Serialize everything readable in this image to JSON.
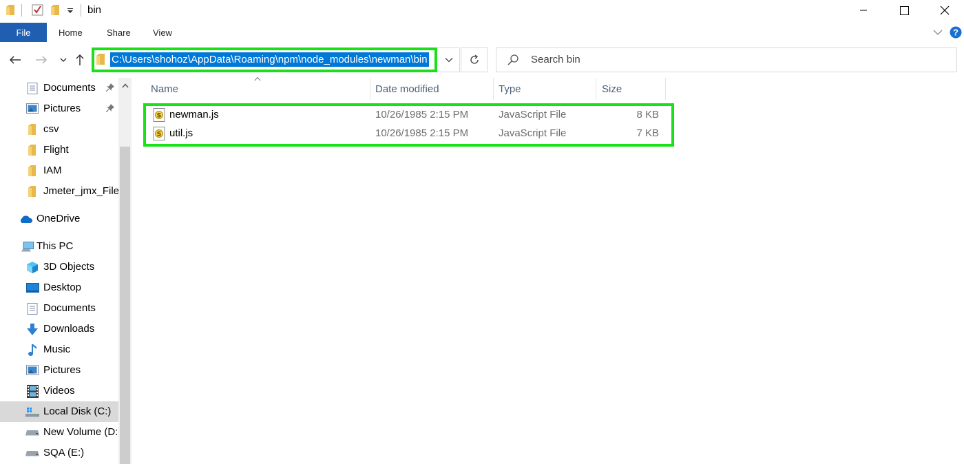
{
  "window": {
    "title": "bin"
  },
  "ribbon": {
    "tabs": [
      "File",
      "Home",
      "Share",
      "View"
    ]
  },
  "address_bar": {
    "path": "C:\\Users\\shohoz\\AppData\\Roaming\\npm\\node_modules\\newman\\bin"
  },
  "search": {
    "placeholder": "Search bin"
  },
  "sidebar": {
    "quick_access": [
      {
        "label": "Documents",
        "icon": "documents-icon",
        "pinned": true
      },
      {
        "label": "Pictures",
        "icon": "pictures-icon",
        "pinned": true
      },
      {
        "label": "csv",
        "icon": "folder-icon",
        "pinned": false
      },
      {
        "label": "Flight",
        "icon": "folder-icon",
        "pinned": false
      },
      {
        "label": "IAM",
        "icon": "folder-icon",
        "pinned": false
      },
      {
        "label": "Jmeter_jmx_Files",
        "icon": "folder-icon",
        "pinned": false
      }
    ],
    "onedrive": "OneDrive",
    "this_pc": "This PC",
    "pc_items": [
      {
        "label": "3D Objects",
        "icon": "3d-objects-icon"
      },
      {
        "label": "Desktop",
        "icon": "desktop-icon"
      },
      {
        "label": "Documents",
        "icon": "documents-icon"
      },
      {
        "label": "Downloads",
        "icon": "downloads-icon"
      },
      {
        "label": "Music",
        "icon": "music-icon"
      },
      {
        "label": "Pictures",
        "icon": "pictures-icon"
      },
      {
        "label": "Videos",
        "icon": "videos-icon"
      },
      {
        "label": "Local Disk (C:)",
        "icon": "local-disk-icon",
        "selected": true
      },
      {
        "label": "New Volume (D:)",
        "icon": "drive-icon"
      },
      {
        "label": "SQA (E:)",
        "icon": "drive-icon"
      }
    ]
  },
  "file_list": {
    "columns": [
      "Name",
      "Date modified",
      "Type",
      "Size"
    ],
    "rows": [
      {
        "name": "newman.js",
        "date_modified": "10/26/1985 2:15 PM",
        "type": "JavaScript File",
        "size": "8 KB"
      },
      {
        "name": "util.js",
        "date_modified": "10/26/1985 2:15 PM",
        "type": "JavaScript File",
        "size": "7 KB"
      }
    ]
  },
  "colors": {
    "highlight": "#19e019",
    "file_tab": "#1f5eb0",
    "selection": "#0078d7"
  }
}
